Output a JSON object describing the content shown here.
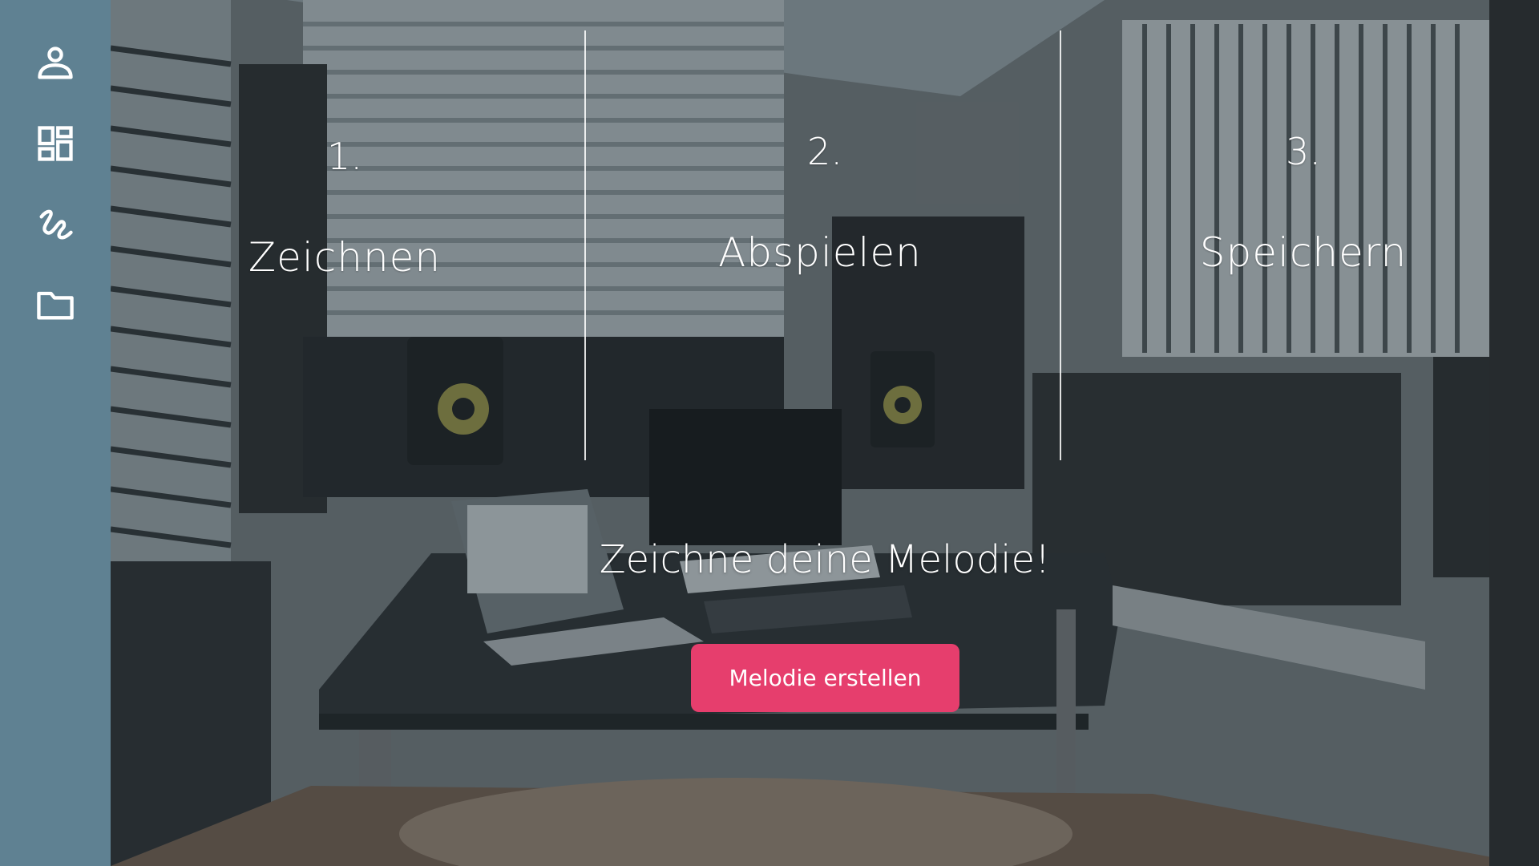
{
  "sidebar": {
    "items": [
      {
        "icon": "user-icon"
      },
      {
        "icon": "dashboard-icon"
      },
      {
        "icon": "scribble-icon"
      },
      {
        "icon": "folder-icon"
      }
    ]
  },
  "steps": [
    {
      "number": "1.",
      "label": "Zeichnen"
    },
    {
      "number": "2.",
      "label": "Abspielen"
    },
    {
      "number": "3.",
      "label": "Speichern"
    }
  ],
  "hero": {
    "headline": "Zeichne deine Melodie!",
    "cta_label": "Melodie erstellen"
  },
  "colors": {
    "sidebar": "#5f8192",
    "accent": "#e63e6d",
    "text": "#ffffff"
  }
}
